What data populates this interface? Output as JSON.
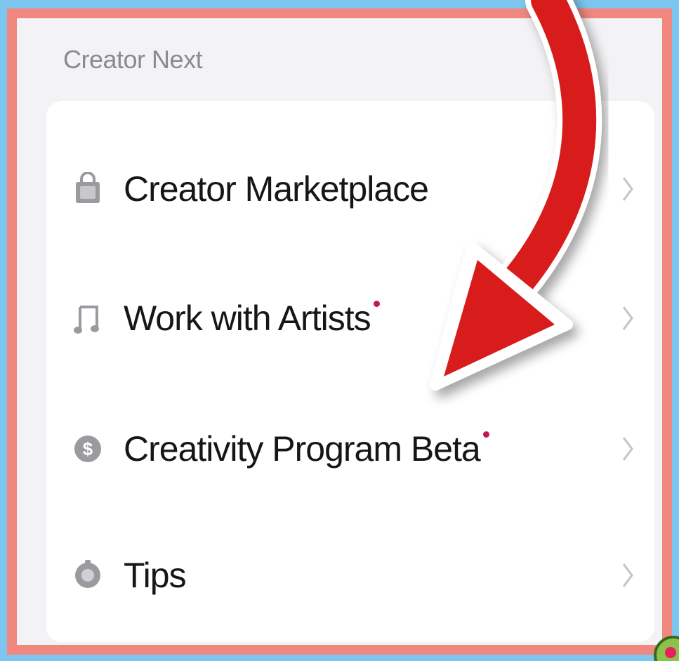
{
  "section": {
    "title": "Creator Next"
  },
  "menu": {
    "items": [
      {
        "label": "Creator Marketplace",
        "icon": "shopping-bag-icon",
        "has_dot": false
      },
      {
        "label": "Work with Artists",
        "icon": "music-note-icon",
        "has_dot": true
      },
      {
        "label": "Creativity Program Beta",
        "icon": "dollar-coin-icon",
        "has_dot": true
      },
      {
        "label": "Tips",
        "icon": "lightbulb-icon",
        "has_dot": false
      }
    ]
  },
  "colors": {
    "frame_border": "#f08880",
    "background_outer": "#7cc6ef",
    "arrow": "#d81b1b",
    "notification_dot": "#c2185b"
  }
}
